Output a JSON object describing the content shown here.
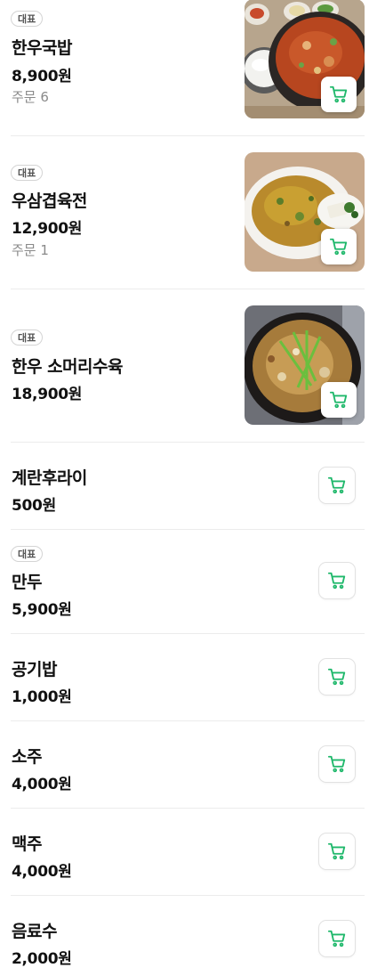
{
  "menu": {
    "accent_color": "#1fb86b",
    "items": [
      {
        "badge": "대표",
        "name": "한우국밥",
        "price": "8,900원",
        "orders": "주문 6",
        "image": "gukbap-photo"
      },
      {
        "badge": "대표",
        "name": "우삼겹육전",
        "price": "12,900원",
        "orders": "주문 1",
        "image": "yukjeon-photo"
      },
      {
        "badge": "대표",
        "name": "한우 소머리수육",
        "price": "18,900원",
        "image": "suyuk-photo"
      },
      {
        "name": "계란후라이",
        "price": "500원"
      },
      {
        "badge": "대표",
        "name": "만두",
        "price": "5,900원"
      },
      {
        "name": "공기밥",
        "price": "1,000원"
      },
      {
        "name": "소주",
        "price": "4,000원"
      },
      {
        "name": "맥주",
        "price": "4,000원"
      },
      {
        "name": "음료수",
        "price": "2,000원"
      }
    ]
  }
}
